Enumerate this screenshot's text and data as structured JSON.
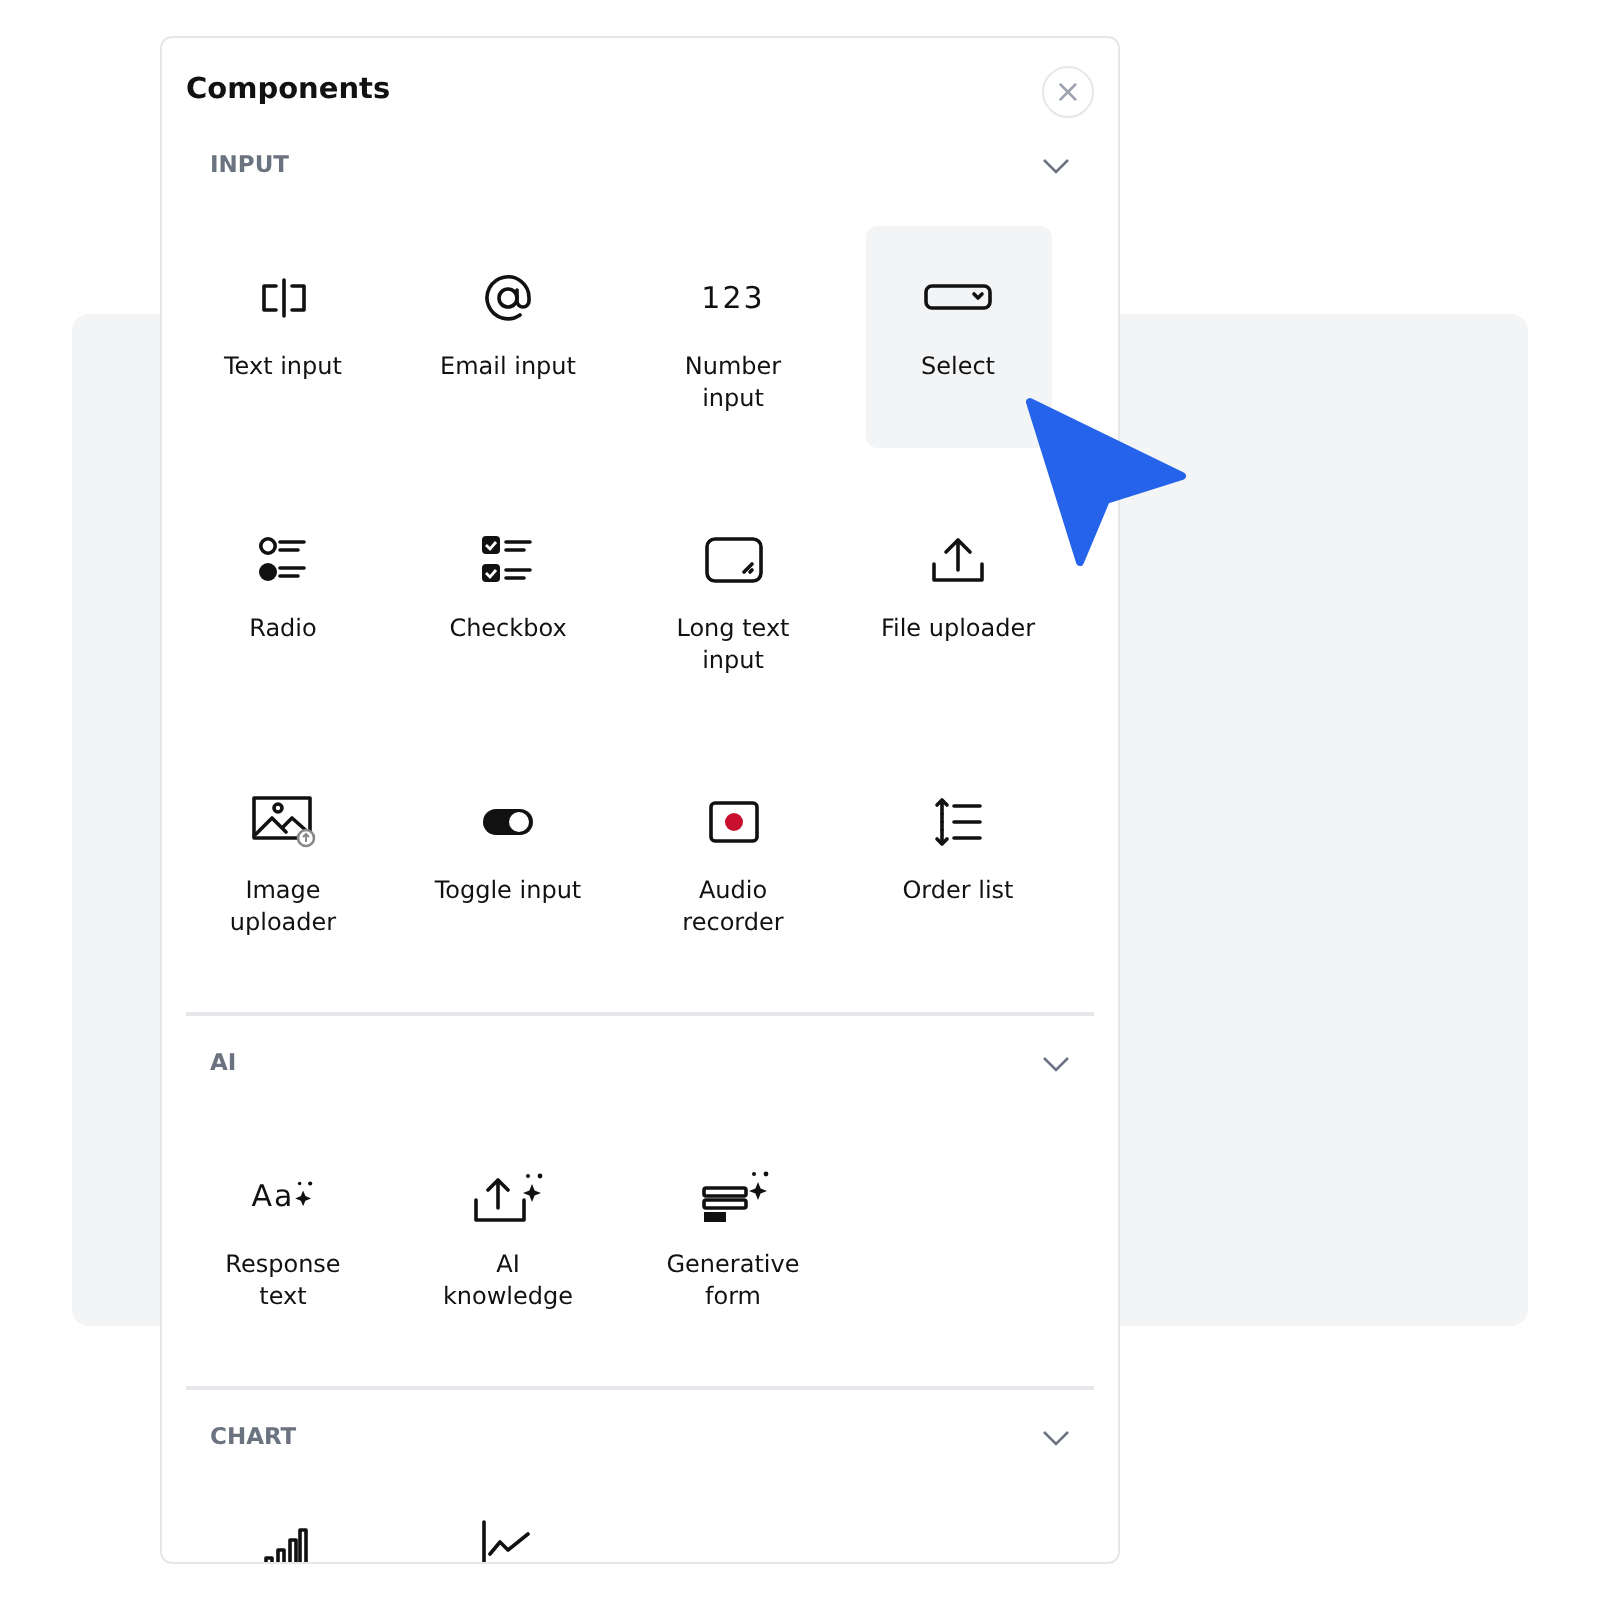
{
  "panel": {
    "title": "Components",
    "close": "×"
  },
  "sections": [
    {
      "name": "INPUT",
      "expanded": true,
      "items": [
        {
          "label": "Text input",
          "kind": "cursor",
          "selected": false
        },
        {
          "label": "Email input",
          "kind": "at",
          "selected": false
        },
        {
          "label": "Number input",
          "kind": "glyph",
          "glyph": "123",
          "selected": false
        },
        {
          "label": "Select",
          "kind": "select",
          "selected": true
        },
        {
          "label": "Radio",
          "kind": "radio",
          "selected": false
        },
        {
          "label": "Checkbox",
          "kind": "checkbox",
          "selected": false
        },
        {
          "label": "Long text input",
          "kind": "textarea",
          "selected": false
        },
        {
          "label": "File uploader",
          "kind": "upload",
          "selected": false
        },
        {
          "label": "Image uploader",
          "kind": "image",
          "selected": false
        },
        {
          "label": "Toggle input",
          "kind": "toggle",
          "selected": false
        },
        {
          "label": "Audio recorder",
          "kind": "record",
          "selected": false
        },
        {
          "label": "Order list",
          "kind": "order",
          "selected": false
        }
      ]
    },
    {
      "name": "AI",
      "expanded": true,
      "items": [
        {
          "label": "Response text",
          "kind": "glyph-sparkle",
          "glyph": "Aa",
          "selected": false
        },
        {
          "label": "AI knowledge",
          "kind": "upload-sparkle",
          "selected": false
        },
        {
          "label": "Generative form",
          "kind": "form-sparkle",
          "selected": false
        }
      ]
    },
    {
      "name": "CHART",
      "expanded": true,
      "items": [
        {
          "kind": "bar-chart",
          "selected": false
        },
        {
          "kind": "line-chart",
          "selected": false
        }
      ]
    }
  ]
}
